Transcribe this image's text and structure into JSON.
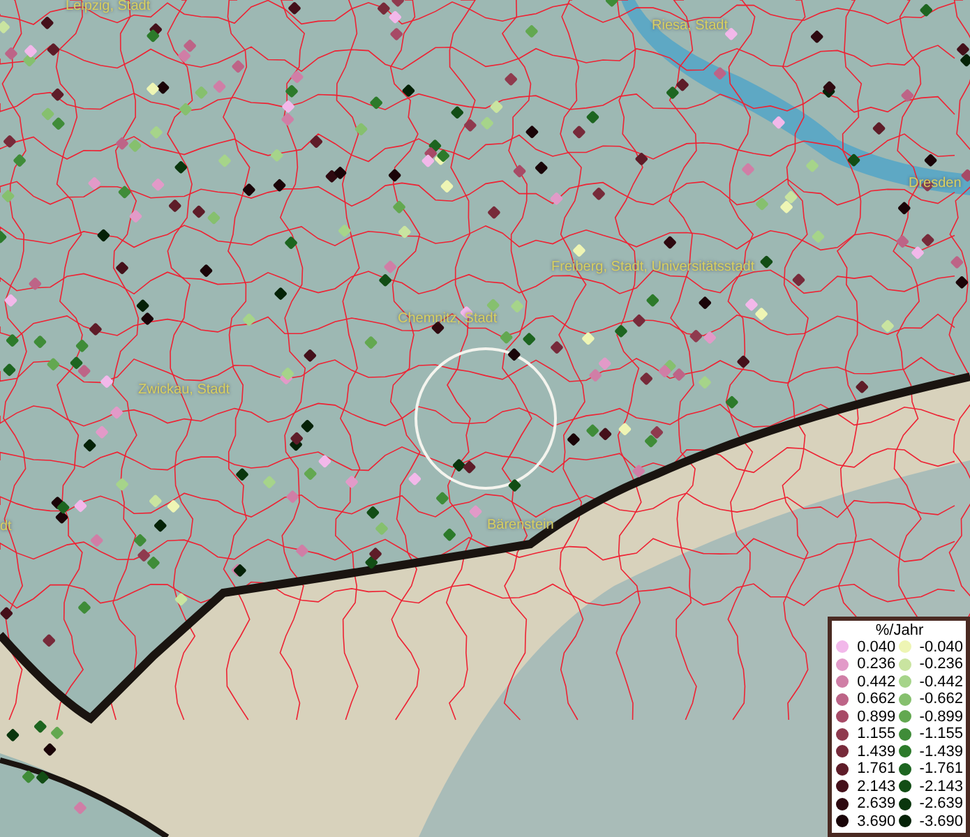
{
  "map": {
    "places": [
      "Leipzig, Stadt",
      "Riesa, Stadt",
      "Dresden",
      "Freiberg, Stadt, Universitätsstadt",
      "Chemnitz, Stadt",
      "Zwickau, Stadt",
      "dt",
      "Bärenstein"
    ]
  },
  "legend": {
    "title": "%/Jahr",
    "positive": [
      {
        "label": "0.040",
        "color": "#f2b8ea"
      },
      {
        "label": "0.236",
        "color": "#e29ac8"
      },
      {
        "label": "0.442",
        "color": "#d07ea6"
      },
      {
        "label": "0.662",
        "color": "#bd6487"
      },
      {
        "label": "0.899",
        "color": "#a74a66"
      },
      {
        "label": "1.155",
        "color": "#8f3a4e"
      },
      {
        "label": "1.439",
        "color": "#772a3a"
      },
      {
        "label": "1.761",
        "color": "#5e1c28"
      },
      {
        "label": "2.143",
        "color": "#44101a"
      },
      {
        "label": "2.639",
        "color": "#2e0910"
      },
      {
        "label": "3.690",
        "color": "#1a0408"
      }
    ],
    "negative": [
      {
        "label": "-0.040",
        "color": "#eef5b4"
      },
      {
        "label": "-0.236",
        "color": "#c9e4a0"
      },
      {
        "label": "-0.442",
        "color": "#a6d48a"
      },
      {
        "label": "-0.662",
        "color": "#86c06e"
      },
      {
        "label": "-0.899",
        "color": "#63a850"
      },
      {
        "label": "-1.155",
        "color": "#3f8c38"
      },
      {
        "label": "-1.439",
        "color": "#2c7a2a"
      },
      {
        "label": "-1.761",
        "color": "#1d6520"
      },
      {
        "label": "-2.143",
        "color": "#124d15"
      },
      {
        "label": "-2.639",
        "color": "#0a360d"
      },
      {
        "label": "-3.690",
        "color": "#052207"
      }
    ]
  }
}
